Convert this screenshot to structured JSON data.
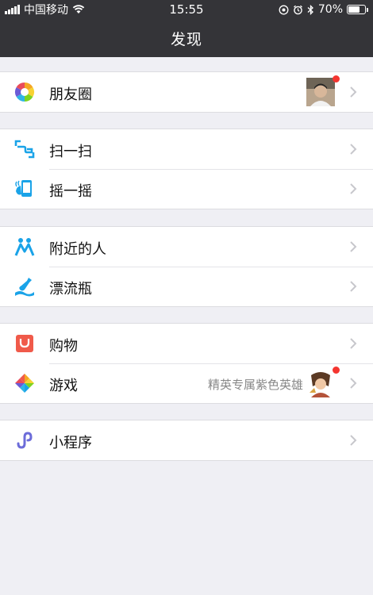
{
  "status_bar": {
    "carrier": "中国移动",
    "time": "15:55",
    "battery": "70%",
    "battery_level": 0.7
  },
  "nav": {
    "title": "发现"
  },
  "groups": [
    {
      "items": [
        {
          "label": "朋友圈",
          "icon": "moments-icon",
          "badge": true
        }
      ]
    },
    {
      "items": [
        {
          "label": "扫一扫",
          "icon": "scan-icon"
        },
        {
          "label": "摇一摇",
          "icon": "shake-icon"
        }
      ]
    },
    {
      "items": [
        {
          "label": "附近的人",
          "icon": "nearby-people-icon"
        },
        {
          "label": "漂流瓶",
          "icon": "drift-bottle-icon"
        }
      ]
    },
    {
      "items": [
        {
          "label": "购物",
          "icon": "shopping-icon"
        },
        {
          "label": "游戏",
          "icon": "games-icon",
          "subtext": "精英专属紫色英雄",
          "badge": true
        }
      ]
    },
    {
      "items": [
        {
          "label": "小程序",
          "icon": "mini-program-icon"
        }
      ]
    }
  ],
  "colors": {
    "navbar": "#343438",
    "background": "#efeff4",
    "badge": "#f43530",
    "accent_blue": "#1aa3e8"
  }
}
